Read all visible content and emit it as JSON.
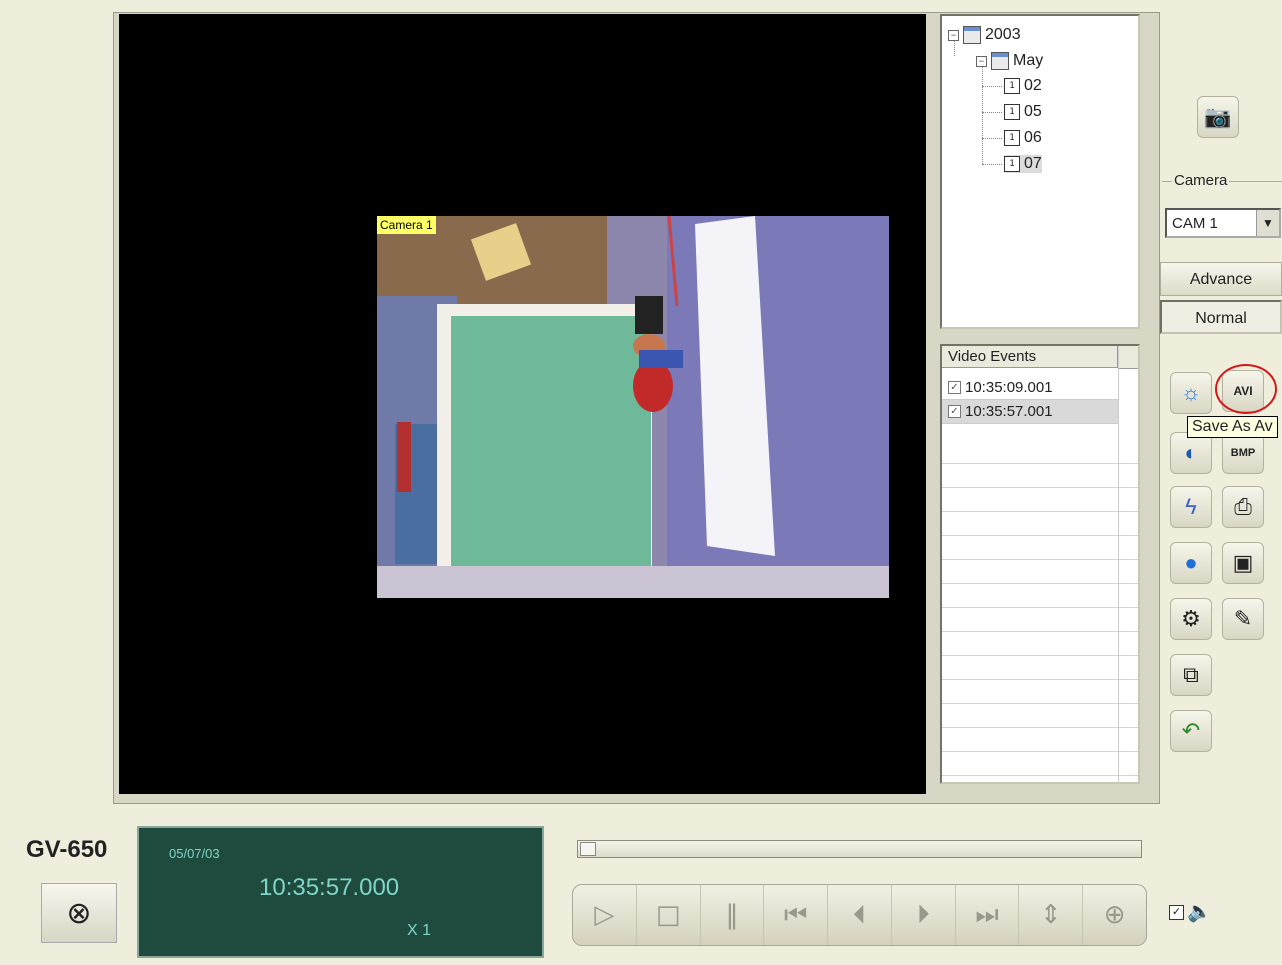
{
  "video": {
    "camera_label": "Camera 1"
  },
  "tree": {
    "year": "2003",
    "month": "May",
    "days": [
      "02",
      "05",
      "06",
      "07"
    ]
  },
  "events": {
    "header": "Video Events",
    "items": [
      "10:35:09.001",
      "10:35:57.001"
    ]
  },
  "camera": {
    "legend": "Camera",
    "selected": "CAM 1"
  },
  "modes": {
    "advance": "Advance",
    "normal": "Normal"
  },
  "tooltip": "Save As Av",
  "model": "GV-650",
  "lcd": {
    "date": "05/07/03",
    "time": "10:35:57.000",
    "speed": "X 1"
  }
}
